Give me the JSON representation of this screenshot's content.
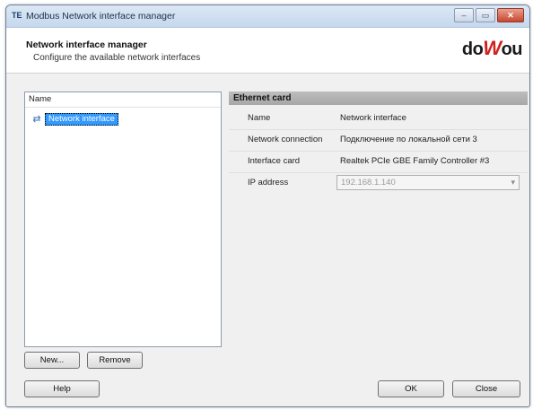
{
  "window": {
    "app_icon": "TE",
    "title": "Modbus Network interface manager",
    "buttons": {
      "minimize": "–",
      "maximize": "▭",
      "close": "✕"
    }
  },
  "header": {
    "title": "Network interface manager",
    "subtitle": "Configure the available network interfaces",
    "logo_left": "do",
    "logo_mid": "W",
    "logo_right": "ou"
  },
  "left_panel": {
    "column_header": "Name",
    "items": [
      {
        "label": "Network interface",
        "icon": "network-icon"
      }
    ]
  },
  "buttons": {
    "new": "New...",
    "remove": "Remove",
    "help": "Help",
    "ok": "OK",
    "close": "Close"
  },
  "right_panel": {
    "header": "Ethernet card",
    "properties": [
      {
        "label": "Name",
        "value": "Network interface"
      },
      {
        "label": "Network connection",
        "value": "Подключение по локальной сети 3"
      },
      {
        "label": "Interface card",
        "value": "Realtek PCIe GBE Family Controller #3"
      },
      {
        "label": "IP address",
        "value": "192.168.1.140"
      }
    ]
  }
}
